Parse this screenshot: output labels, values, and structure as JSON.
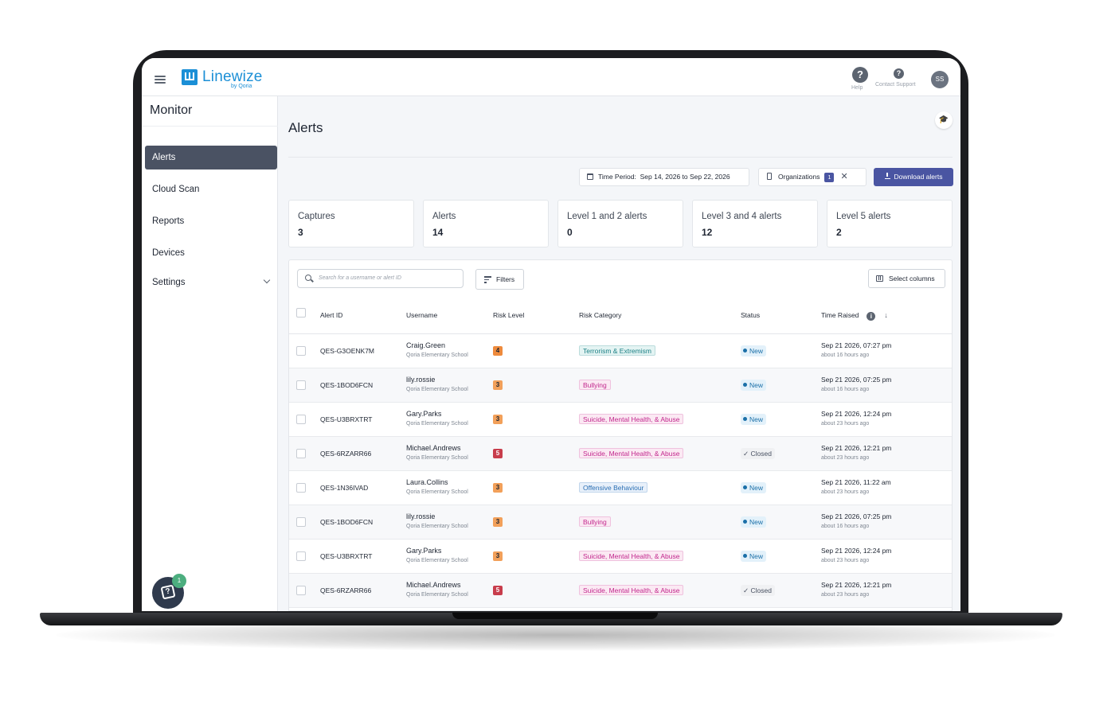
{
  "app": {
    "logo_name": "Linewize",
    "logo_sub": "by Qoria",
    "help_label": "Help",
    "support_label": "Contact Support",
    "user_initials": "SS"
  },
  "sidebar": {
    "title": "Monitor",
    "items": [
      {
        "label": "Alerts",
        "active": true
      },
      {
        "label": "Cloud Scan"
      },
      {
        "label": "Reports"
      },
      {
        "label": "Devices"
      },
      {
        "label": "Settings",
        "expandable": true
      }
    ],
    "chat_badge": "1"
  },
  "main": {
    "title": "Alerts",
    "time_period_label": "Time Period:",
    "time_period_value": "Sep 14, 2026 to Sep 22, 2026",
    "organizations_label": "Organizations",
    "organizations_count": "1",
    "download_label": "Download alerts",
    "stats": [
      {
        "label": "Captures",
        "value": "3"
      },
      {
        "label": "Alerts",
        "value": "14"
      },
      {
        "label": "Level 1 and 2 alerts",
        "value": "0"
      },
      {
        "label": "Level 3 and 4 alerts",
        "value": "12"
      },
      {
        "label": "Level 5 alerts",
        "value": "2"
      }
    ],
    "search_placeholder": "Search for a username or alert ID",
    "filters_label": "Filters",
    "select_columns_label": "Select columns",
    "columns": [
      "Alert ID",
      "Username",
      "Risk Level",
      "Risk Category",
      "Status",
      "Time Raised"
    ],
    "rows": [
      {
        "id": "QES-G3OENK7M",
        "user": "Craig.Green",
        "school": "Qoria Elementary School",
        "risk": "4",
        "category": "Terrorism & Extremism",
        "status": "New",
        "time": "Sep 21 2026, 07:27 pm",
        "ago": "about 16 hours ago"
      },
      {
        "id": "QES-1BOD6FCN",
        "user": "lily.rossie",
        "school": "Qoria Elementary School",
        "risk": "3",
        "category": "Bullying",
        "status": "New",
        "time": "Sep 21 2026, 07:25 pm",
        "ago": "about 16 hours ago"
      },
      {
        "id": "QES-U3BRXTRT",
        "user": "Gary.Parks",
        "school": "Qoria Elementary School",
        "risk": "3",
        "category": "Suicide, Mental Health, & Abuse",
        "status": "New",
        "time": "Sep 21 2026, 12:24 pm",
        "ago": "about 23 hours ago"
      },
      {
        "id": "QES-6RZARR66",
        "user": "Michael.Andrews",
        "school": "Qoria Elementary School",
        "risk": "5",
        "category": "Suicide, Mental Health, & Abuse",
        "status": "Closed",
        "time": "Sep 21 2026, 12:21 pm",
        "ago": "about 23 hours ago"
      },
      {
        "id": "QES-1N36IVAD",
        "user": "Laura.Collins",
        "school": "Qoria Elementary School",
        "risk": "3",
        "category": "Offensive Behaviour",
        "status": "New",
        "time": "Sep 21 2026, 11:22 am",
        "ago": "about 23 hours ago"
      },
      {
        "id": "QES-1BOD6FCN",
        "user": "lily.rossie",
        "school": "Qoria Elementary School",
        "risk": "3",
        "category": "Bullying",
        "status": "New",
        "time": "Sep 21 2026, 07:25 pm",
        "ago": "about 16 hours ago"
      },
      {
        "id": "QES-U3BRXTRT",
        "user": "Gary.Parks",
        "school": "Qoria Elementary School",
        "risk": "3",
        "category": "Suicide, Mental Health, & Abuse",
        "status": "New",
        "time": "Sep 21 2026, 12:24 pm",
        "ago": "about 23 hours ago"
      },
      {
        "id": "QES-6RZARR66",
        "user": "Michael.Andrews",
        "school": "Qoria Elementary School",
        "risk": "5",
        "category": "Suicide, Mental Health, & Abuse",
        "status": "Closed",
        "time": "Sep 21 2026, 12:21 pm",
        "ago": "about 23 hours ago"
      }
    ]
  },
  "colors": {
    "brand": "#1b8fd6",
    "accent": "#4a55a2",
    "risk_3": "#f2a05a",
    "risk_4": "#ee8a3c",
    "risk_5": "#c83d4c",
    "cat_teal": "#1a7f84",
    "cat_magenta": "#c2278d",
    "cat_blue": "#2a6fb3",
    "status_new": "#1a6fa8"
  }
}
